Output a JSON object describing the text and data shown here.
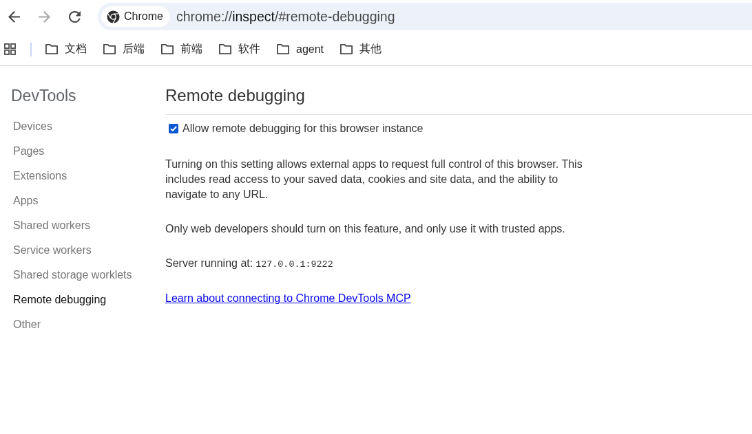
{
  "toolbar": {
    "nav_buttons": [
      {
        "kind": "back",
        "disabled": false
      },
      {
        "kind": "forward",
        "disabled": true
      },
      {
        "kind": "reload",
        "disabled": false
      }
    ],
    "omnibox": {
      "chip_label": "Chrome",
      "url_parts": [
        {
          "text": "chrome://",
          "emphasis": false
        },
        {
          "text": "inspect",
          "emphasis": true
        },
        {
          "text": "/#remote-debugging",
          "emphasis": false
        }
      ]
    }
  },
  "bookmarks_bar": {
    "items": [
      {
        "label": "文档"
      },
      {
        "label": "后端"
      },
      {
        "label": "前端"
      },
      {
        "label": "软件"
      },
      {
        "label": "agent"
      },
      {
        "label": "其他"
      }
    ]
  },
  "sidebar": {
    "title": "DevTools",
    "items": [
      {
        "label": "Devices",
        "selected": false
      },
      {
        "label": "Pages",
        "selected": false
      },
      {
        "label": "Extensions",
        "selected": false
      },
      {
        "label": "Apps",
        "selected": false
      },
      {
        "label": "Shared workers",
        "selected": false
      },
      {
        "label": "Service workers",
        "selected": false
      },
      {
        "label": "Shared storage worklets",
        "selected": false
      },
      {
        "label": "Remote debugging",
        "selected": true
      },
      {
        "label": "Other",
        "selected": false
      }
    ]
  },
  "main": {
    "heading": "Remote debugging",
    "setting": {
      "label": "Allow remote debugging for this browser instance",
      "checked": true
    },
    "paragraphs": [
      "Turning on this setting allows external apps to request full control of this browser. This includes read access to your saved data, cookies and site data, and the ability to navigate to any URL.",
      "Only web developers should turn on this feature, and only use it with trusted apps."
    ],
    "server_status": {
      "label": "Server running at:",
      "address": "127.0.0.1:9222"
    },
    "link": "Learn about connecting to Chrome DevTools MCP"
  }
}
